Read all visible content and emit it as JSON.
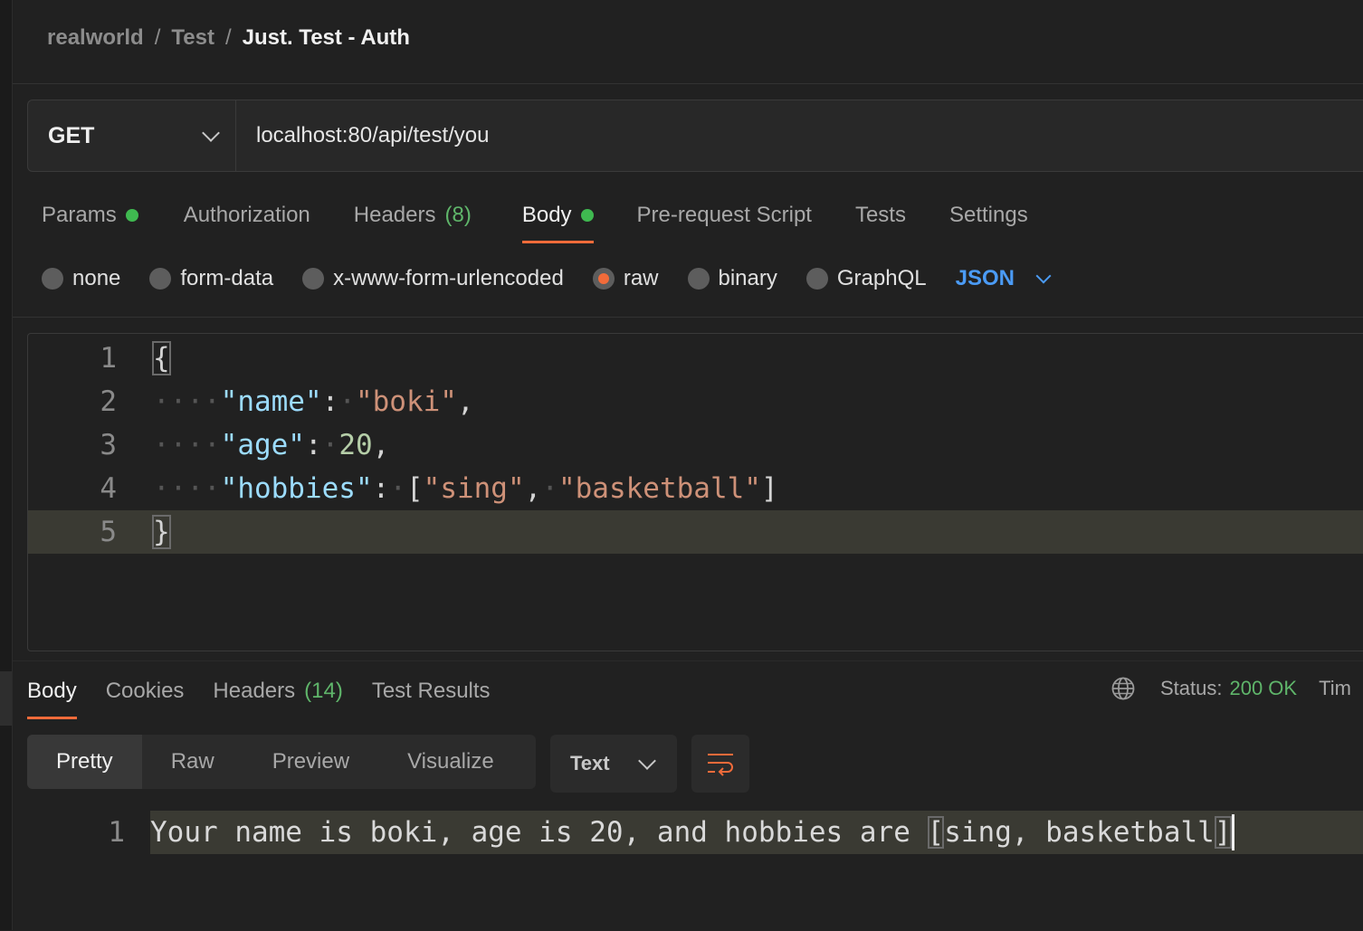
{
  "breadcrumb": {
    "items": [
      "realworld",
      "Test"
    ],
    "current": "Just. Test - Auth",
    "separator": "/"
  },
  "request": {
    "method": "GET",
    "url": "localhost:80/api/test/you"
  },
  "request_tabs": {
    "params": "Params",
    "authorization": "Authorization",
    "headers": "Headers",
    "headers_count": "(8)",
    "body": "Body",
    "pre_request": "Pre-request Script",
    "tests": "Tests",
    "settings": "Settings",
    "active": "Body"
  },
  "body_modes": {
    "none": "none",
    "form_data": "form-data",
    "urlencoded": "x-www-form-urlencoded",
    "raw": "raw",
    "binary": "binary",
    "graphql": "GraphQL",
    "selected": "raw",
    "language": "JSON"
  },
  "editor": {
    "lines": [
      {
        "num": "1",
        "text": "{"
      },
      {
        "num": "2",
        "key": "\"name\"",
        "value": "\"boki\""
      },
      {
        "num": "3",
        "key": "\"age\"",
        "value": "20"
      },
      {
        "num": "4",
        "key": "\"hobbies\"",
        "values": [
          "\"sing\"",
          "\"basketball\""
        ]
      },
      {
        "num": "5",
        "text": "}"
      }
    ]
  },
  "response_tabs": {
    "body": "Body",
    "cookies": "Cookies",
    "headers": "Headers",
    "headers_count": "(14)",
    "test_results": "Test Results"
  },
  "status": {
    "label": "Status:",
    "value": "200 OK",
    "time_label": "Tim"
  },
  "view_modes": {
    "pretty": "Pretty",
    "raw": "Raw",
    "preview": "Preview",
    "visualize": "Visualize",
    "format": "Text"
  },
  "response": {
    "line_num": "1",
    "text_before": "Your name is boki, age is 20, and hobbies are ",
    "open_bracket": "[",
    "list": "sing, basketball",
    "close_bracket": "]"
  },
  "colors": {
    "accent": "#f26b3a",
    "success": "#3fb950",
    "link": "#4b9bf5",
    "background": "#212121"
  }
}
